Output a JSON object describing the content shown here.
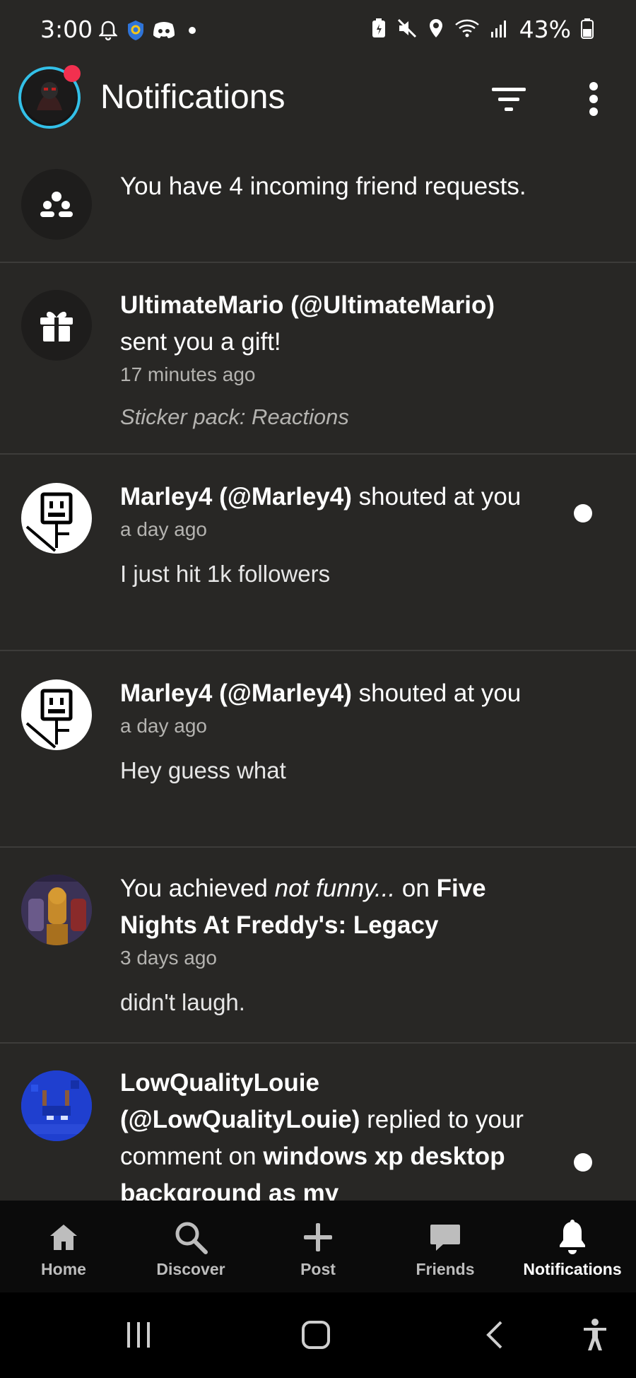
{
  "status_bar": {
    "time": "3:00",
    "battery": "43%",
    "icons": [
      "bell-icon",
      "vpn-icon",
      "discord-icon",
      "dot-icon",
      "battery-saver-icon",
      "mute-icon",
      "location-icon",
      "wifi-icon",
      "signal-icon",
      "battery-icon"
    ]
  },
  "header": {
    "title": "Notifications",
    "avatar_badge_color": "#f2304f",
    "avatar_ring_color": "#33c0e8"
  },
  "notifications": [
    {
      "type": "friend-requests",
      "icon": "people-icon",
      "text": "You have 4 incoming friend requests."
    },
    {
      "type": "gift",
      "icon": "gift-icon",
      "user": "UltimateMario (@UltimateMario)",
      "action": "sent you a gift!",
      "time": "17 minutes ago",
      "detail": "Sticker pack: Reactions"
    },
    {
      "type": "shout",
      "icon": "stickman-avatar",
      "user": "Marley4 (@Marley4)",
      "action": "shouted at you",
      "time": "a day ago",
      "detail": "I just hit 1k followers",
      "unread": true
    },
    {
      "type": "shout",
      "icon": "stickman-avatar",
      "user": "Marley4 (@Marley4)",
      "action": "shouted at you",
      "time": "a day ago",
      "detail": "Hey guess what"
    },
    {
      "type": "achievement",
      "icon": "game-avatar",
      "prefix": "You achieved ",
      "achievement": "not funny...",
      "mid": " on ",
      "game": "Five Nights At Freddy's: Legacy",
      "time": "3 days ago",
      "detail": "didn't laugh."
    },
    {
      "type": "reply",
      "icon": "pixel-avatar",
      "user": "LowQualityLouie (@LowQualityLouie)",
      "action": " replied to your comment on ",
      "post": "windows xp desktop background as my",
      "unread": true
    }
  ],
  "bottom_nav": [
    {
      "label": "Home",
      "icon": "home-icon"
    },
    {
      "label": "Discover",
      "icon": "search-icon"
    },
    {
      "label": "Post",
      "icon": "plus-icon"
    },
    {
      "label": "Friends",
      "icon": "chat-icon"
    },
    {
      "label": "Notifications",
      "icon": "bell-icon",
      "active": true
    }
  ]
}
